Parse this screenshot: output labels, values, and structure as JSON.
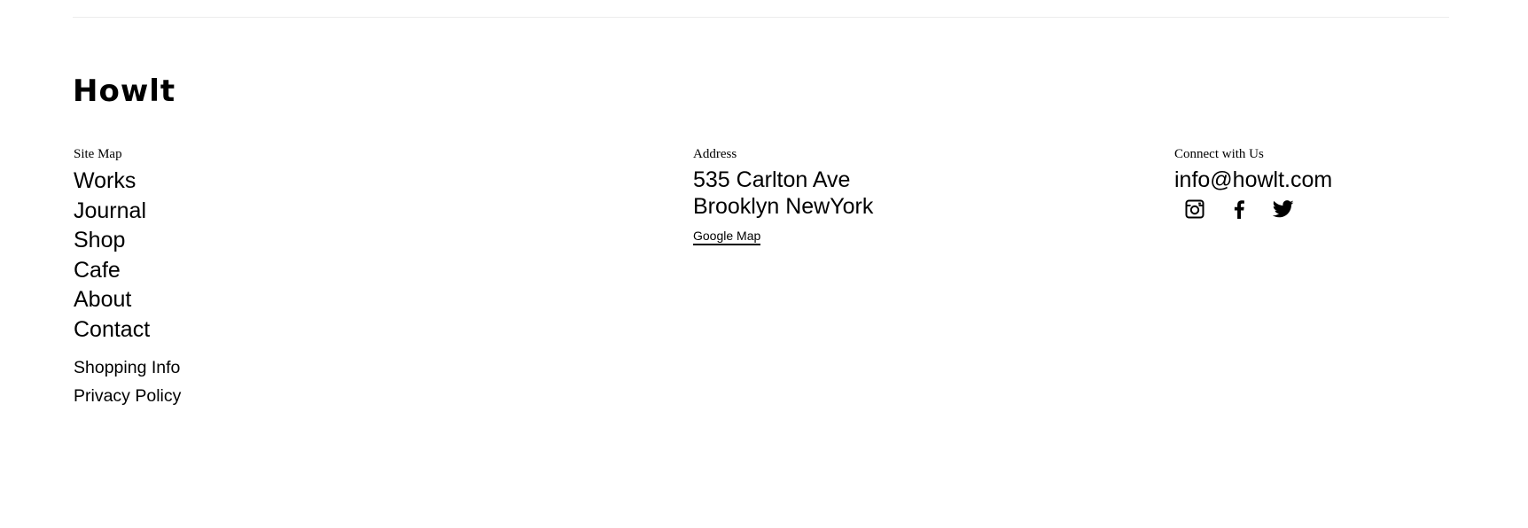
{
  "brand": {
    "logo_text": "Howlt"
  },
  "sitemap": {
    "heading": "Site Map",
    "main_links": [
      {
        "label": "Works"
      },
      {
        "label": "Journal"
      },
      {
        "label": "Shop"
      },
      {
        "label": "Cafe"
      },
      {
        "label": "About"
      },
      {
        "label": "Contact"
      }
    ],
    "secondary_links": [
      {
        "label": "Shopping Info"
      },
      {
        "label": "Privacy Policy"
      }
    ]
  },
  "address": {
    "heading": "Address",
    "line1": "535 Carlton Ave",
    "line2": "Brooklyn NewYork",
    "map_link_label": "Google Map"
  },
  "connect": {
    "heading": "Connect with Us",
    "email": "info@howlt.com",
    "socials": [
      {
        "icon": "instagram-icon"
      },
      {
        "icon": "facebook-icon"
      },
      {
        "icon": "twitter-icon"
      }
    ]
  },
  "colors": {
    "text": "#000000",
    "background": "#ffffff",
    "divider": "#ececec"
  }
}
